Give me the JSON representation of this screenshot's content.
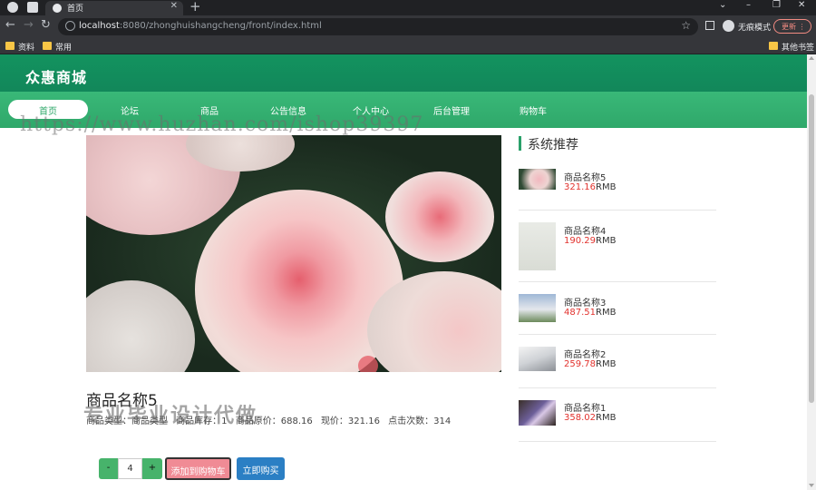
{
  "browser": {
    "tab_title": "首页",
    "url_host": "localhost",
    "url_path": ":8080/zhonghuishangcheng/front/index.html",
    "profile_label": "无痕模式",
    "update_label": "更新",
    "bookmarks": [
      "资料",
      "常用",
      "其他书签"
    ]
  },
  "site": {
    "title": "众惠商城",
    "nav": [
      "首页",
      "论坛",
      "商品",
      "公告信息",
      "个人中心",
      "后台管理",
      "购物车"
    ]
  },
  "watermarks": {
    "url": "https://www.huzhan.com/ishop39397",
    "text": "专业毕业设计代做"
  },
  "product": {
    "name": "商品名称5",
    "meta": [
      "商品类型：商品类型",
      "商品库存：1",
      "商品原价：688.16",
      "现价：321.16",
      "点击次数：314"
    ],
    "quantity": "4",
    "minus_label": "-",
    "plus_label": "+",
    "add_cart_label": "添加到购物车",
    "buy_now_label": "立即购买"
  },
  "recommend": {
    "title": "系统推荐",
    "currency": "RMB",
    "items": [
      {
        "name": "商品名称5",
        "price": "321.16"
      },
      {
        "name": "商品名称4",
        "price": "190.29"
      },
      {
        "name": "商品名称3",
        "price": "487.51"
      },
      {
        "name": "商品名称2",
        "price": "259.78"
      },
      {
        "name": "商品名称1",
        "price": "358.02"
      }
    ]
  },
  "colors": {
    "header": "#12875a",
    "nav": "#2fa86a",
    "price": "#e2322d",
    "add_cart": "#f08b95",
    "buy_now": "#2b7fc4",
    "qty_button": "#47b36b"
  }
}
